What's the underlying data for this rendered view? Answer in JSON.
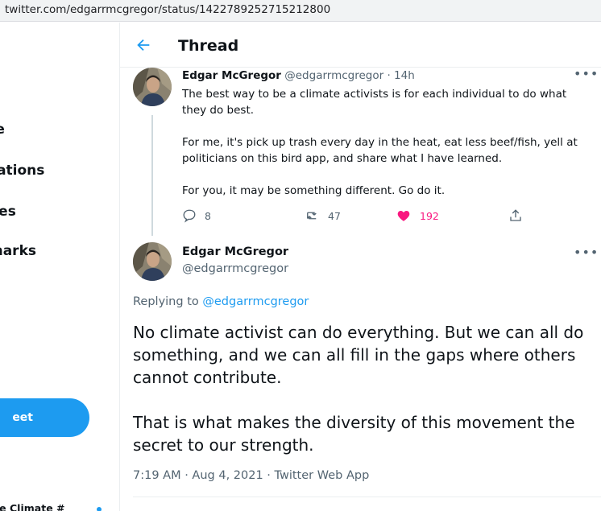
{
  "browser": {
    "url": "twitter.com/edgarrmcgregor/status/1422789252715212800"
  },
  "sidebar": {
    "items": [
      {
        "label": "re"
      },
      {
        "label": "cations"
      },
      {
        "label": "ges"
      },
      {
        "label": "marks"
      },
      {
        "label": "e"
      }
    ],
    "tweet_button_label": "eet",
    "account_label": "ine Climate #"
  },
  "header": {
    "title": "Thread"
  },
  "tweet1": {
    "author_name": "Edgar McGregor",
    "handle_time": "@edgarrmcgregor · 14h",
    "paragraphs": [
      "The best way to be a climate activists is for each individual to do what they do best.",
      "For me, it's pick up trash every day in the heat, eat less beef/fish, yell at politicians on this bird app, and share what I have learned.",
      "For you, it may be something different. Go do it."
    ],
    "replies": "8",
    "retweets": "47",
    "likes": "192",
    "like_color": "#f91880"
  },
  "tweet2": {
    "author_name": "Edgar McGregor",
    "handle": "@edgarrmcgregor",
    "replying_prefix": "Replying to",
    "replying_to": "@edgarrmcgregor",
    "paragraphs": [
      "No climate activist can do everything. But we can all do something, and we can all fill in the gaps where others cannot contribute.",
      "That is what makes the diversity of this movement the secret to our strength."
    ],
    "meta": "7:19 AM · Aug 4, 2021 · Twitter Web App"
  },
  "colors": {
    "accent": "#1d9bf0",
    "muted": "#536471"
  },
  "icons": [
    "back-arrow-icon",
    "more-icon",
    "reply-icon",
    "retweet-icon",
    "heart-icon",
    "share-icon"
  ]
}
